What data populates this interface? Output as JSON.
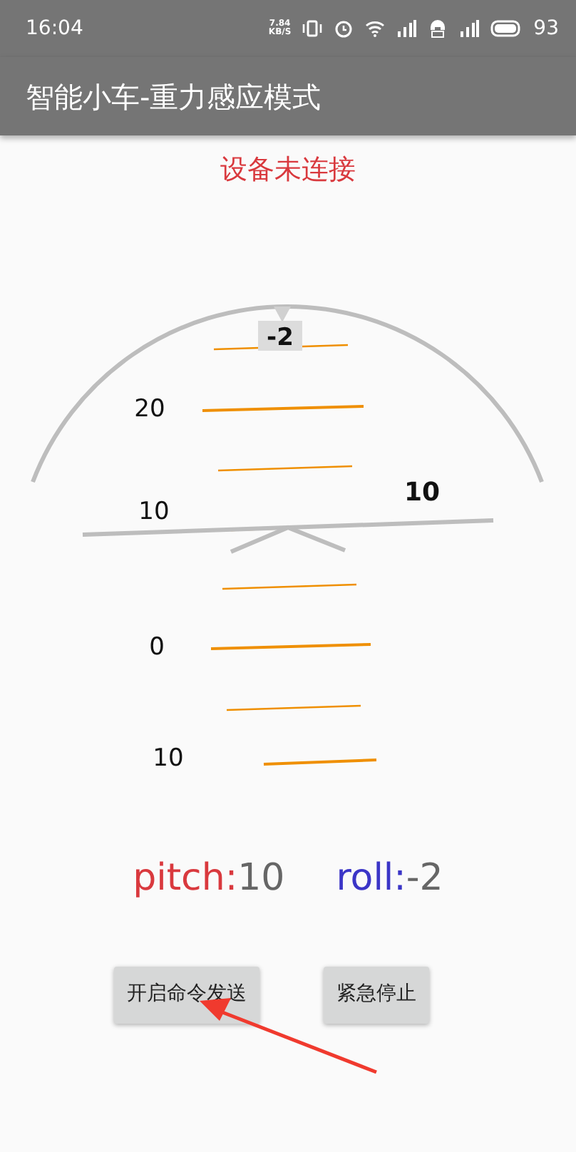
{
  "status_bar": {
    "time": "16:04",
    "net_speed_value": "7.84",
    "net_speed_unit": "KB/S",
    "battery": "93"
  },
  "app_bar": {
    "title": "智能小车-重力感应模式"
  },
  "connection_status": {
    "text": "设备未连接"
  },
  "attitude_indicator": {
    "roll_label": "-2",
    "pitch_label": "10",
    "ladder_labels": [
      "20",
      "10",
      "0",
      "10"
    ]
  },
  "readouts": [
    {
      "label": "pitch:",
      "value": "10",
      "color": "#d9393e"
    },
    {
      "label": "roll:",
      "value": "-2",
      "color": "#3b35c7"
    }
  ],
  "buttons": [
    "开启命令发送",
    "紧急停止"
  ]
}
